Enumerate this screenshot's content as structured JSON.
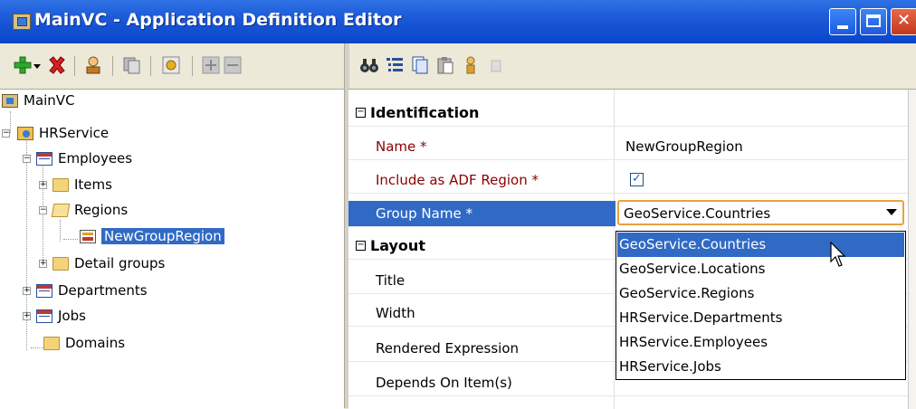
{
  "window": {
    "title": "MainVC - Application Definition Editor"
  },
  "tree": {
    "items": [
      {
        "label": "MainVC"
      },
      {
        "label": "HRService"
      },
      {
        "label": "Employees"
      },
      {
        "label": "Items"
      },
      {
        "label": "Regions"
      },
      {
        "label": "NewGroupRegion"
      },
      {
        "label": "Detail groups"
      },
      {
        "label": "Departments"
      },
      {
        "label": "Jobs"
      },
      {
        "label": "Domains"
      }
    ]
  },
  "properties": {
    "identification": {
      "title": "Identification",
      "name_label": "Name *",
      "name_value": "NewGroupRegion",
      "include_label": "Include as ADF Region *",
      "include_checked": true,
      "group_label": "Group Name *",
      "group_value": "GeoService.Countries"
    },
    "layout": {
      "title": "Layout",
      "title_label": "Title",
      "width_label": "Width",
      "rendered_label": "Rendered Expression",
      "depends_label": "Depends On Item(s)"
    }
  },
  "dropdown": {
    "options": [
      "GeoService.Countries",
      "GeoService.Locations",
      "GeoService.Regions",
      "HRService.Departments",
      "HRService.Employees",
      "HRService.Jobs"
    ],
    "selected_index": 0
  },
  "colors": {
    "selection": "#316ac5",
    "required_label": "#8b0000",
    "combo_border": "#e8a33a"
  }
}
